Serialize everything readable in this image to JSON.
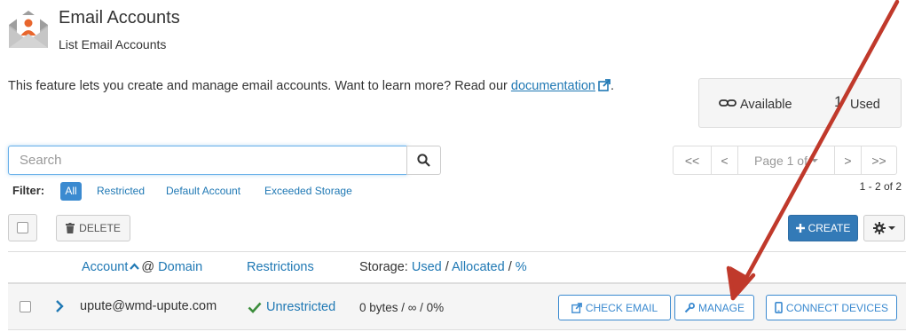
{
  "header": {
    "title": "Email Accounts",
    "subtitle": "List Email Accounts",
    "icon": "email-envelope-icon"
  },
  "description": {
    "text": "This feature lets you create and manage email accounts. Want to learn more? Read our ",
    "link_text": "documentation",
    "trailing": "."
  },
  "stats": {
    "available_label": "Available",
    "used_count": "1",
    "used_label": "Used"
  },
  "search": {
    "placeholder": "Search",
    "value": ""
  },
  "pagination": {
    "first": "<<",
    "prev": "<",
    "page_label": "Page 1 of",
    "next": ">",
    "last": ">>",
    "range": "1 - 2 of 2"
  },
  "filter": {
    "label": "Filter:",
    "options": [
      "All",
      "Restricted",
      "Default Account",
      "Exceeded Storage"
    ],
    "active": "All"
  },
  "toolbar": {
    "delete_label": "DELETE",
    "create_label": "CREATE"
  },
  "table": {
    "headers": {
      "account": "Account",
      "at_domain": "@",
      "domain": "Domain",
      "restrictions": "Restrictions",
      "storage_prefix": "Storage:",
      "storage_used": "Used",
      "slash1": "/",
      "storage_allocated": "Allocated",
      "slash2": "/",
      "storage_percent": "%"
    },
    "rows": [
      {
        "account": "upute@wmd-upute.com",
        "restriction": "Unrestricted",
        "storage": "0 bytes / ∞ / 0%",
        "actions": {
          "check_email": "CHECK EMAIL",
          "manage": "MANAGE",
          "connect_devices": "CONNECT DEVICES"
        }
      }
    ]
  },
  "colors": {
    "link": "#1f78b4",
    "primary": "#337ab7",
    "annotation_arrow": "#c0392b"
  }
}
